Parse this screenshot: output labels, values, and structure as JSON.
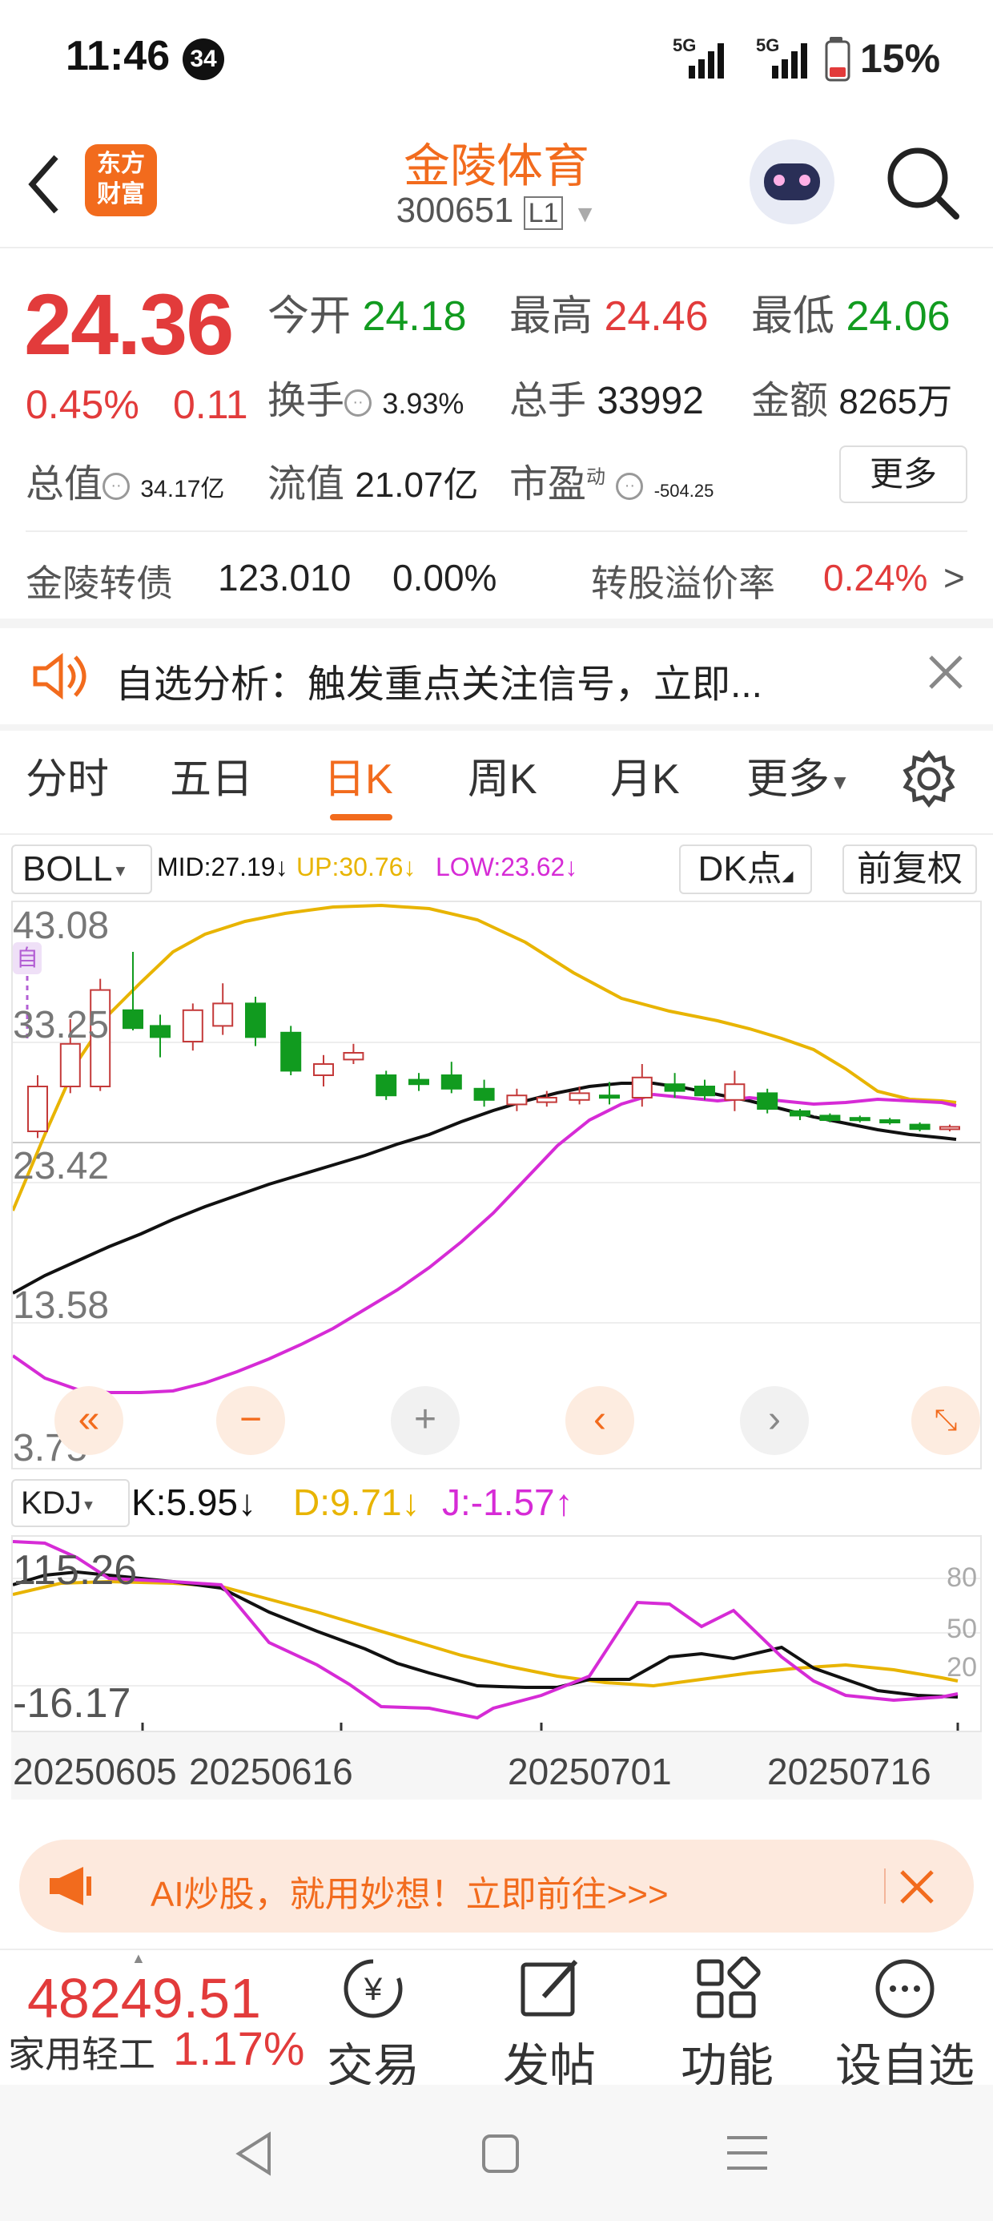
{
  "status_bar": {
    "time": "11:46",
    "badge": "34",
    "signal1": "5G",
    "signal2": "5G",
    "battery": "15%"
  },
  "header": {
    "logo_line1": "东方",
    "logo_line2": "财富",
    "title": "金陵体育",
    "code": "300651",
    "level": "L1"
  },
  "quote": {
    "price": "24.36",
    "change_pct": "0.45%",
    "change_abs": "0.11",
    "open_label": "今开",
    "open": "24.18",
    "high_label": "最高",
    "high": "24.46",
    "low_label": "最低",
    "low": "24.06",
    "turnover_label": "换手",
    "turnover": "3.93%",
    "volume_label": "总手",
    "volume": "33992",
    "amount_label": "金额",
    "amount": "8265万",
    "mktcap_label": "总值",
    "mktcap": "34.17亿",
    "float_label": "流值",
    "float_cap": "21.07亿",
    "pe_label": "市盈",
    "pe_sup": "动",
    "pe": "-504.25",
    "more_button": "更多"
  },
  "bond": {
    "name": "金陵转债",
    "price": "123.010",
    "change": "0.00%",
    "premium_label": "转股溢价率",
    "premium": "0.24%"
  },
  "notice": {
    "text": "自选分析：触发重点关注信号，立即..."
  },
  "tabs": [
    "分时",
    "五日",
    "日K",
    "周K",
    "月K",
    "更多"
  ],
  "active_tab": "日K",
  "boll": {
    "name": "BOLL",
    "mid": "MID:27.19↓",
    "up": "UP:30.76↓",
    "low": "LOW:23.62↓",
    "dk_button": "DK点",
    "adjust_button": "前复权"
  },
  "main_axis": {
    "labels": [
      "43.08",
      "33.25",
      "23.42",
      "13.58",
      "3.75"
    ],
    "self_tag": "自"
  },
  "kdj": {
    "name": "KDJ",
    "k": "K:5.95↓",
    "d": "D:9.71↓",
    "j": "J:-1.57↑",
    "y_top": "115.26",
    "y_bottom": "-16.17",
    "levels": [
      "80",
      "50",
      "20"
    ]
  },
  "dates": [
    "20250605",
    "20250616",
    "20250701",
    "20250716"
  ],
  "ad_banner": {
    "text": "AI炒股，就用妙想！立即前往>>>"
  },
  "index": {
    "value": "48249.51",
    "name": "家用轻工",
    "change": "1.17%"
  },
  "bottom_nav": [
    "交易",
    "发帖",
    "功能",
    "设自选"
  ],
  "colors": {
    "accent": "#f26b1d",
    "up": "#e23b3b",
    "down": "#119b1f",
    "boll_up": "#e8b400",
    "boll_low": "#d62bd6",
    "mid": "#111111"
  }
}
